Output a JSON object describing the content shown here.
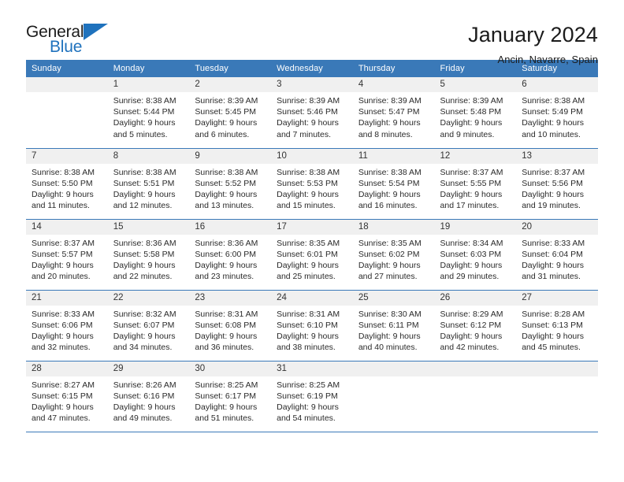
{
  "brand": {
    "name_top": "General",
    "name_bottom": "Blue",
    "accent_color": "#1f72bd"
  },
  "header": {
    "title": "January 2024",
    "subtitle": "Ancin, Navarre, Spain"
  },
  "calendar": {
    "header_bg": "#3a79b8",
    "daynum_bg": "#f0f0f0",
    "weekday_headers": [
      "Sunday",
      "Monday",
      "Tuesday",
      "Wednesday",
      "Thursday",
      "Friday",
      "Saturday"
    ],
    "weeks": [
      [
        {
          "day": "",
          "blank": true,
          "sunrise": "",
          "sunset": "",
          "daylight_1": "",
          "daylight_2": ""
        },
        {
          "day": "1",
          "sunrise": "Sunrise: 8:38 AM",
          "sunset": "Sunset: 5:44 PM",
          "daylight_1": "Daylight: 9 hours",
          "daylight_2": "and 5 minutes."
        },
        {
          "day": "2",
          "sunrise": "Sunrise: 8:39 AM",
          "sunset": "Sunset: 5:45 PM",
          "daylight_1": "Daylight: 9 hours",
          "daylight_2": "and 6 minutes."
        },
        {
          "day": "3",
          "sunrise": "Sunrise: 8:39 AM",
          "sunset": "Sunset: 5:46 PM",
          "daylight_1": "Daylight: 9 hours",
          "daylight_2": "and 7 minutes."
        },
        {
          "day": "4",
          "sunrise": "Sunrise: 8:39 AM",
          "sunset": "Sunset: 5:47 PM",
          "daylight_1": "Daylight: 9 hours",
          "daylight_2": "and 8 minutes."
        },
        {
          "day": "5",
          "sunrise": "Sunrise: 8:39 AM",
          "sunset": "Sunset: 5:48 PM",
          "daylight_1": "Daylight: 9 hours",
          "daylight_2": "and 9 minutes."
        },
        {
          "day": "6",
          "sunrise": "Sunrise: 8:38 AM",
          "sunset": "Sunset: 5:49 PM",
          "daylight_1": "Daylight: 9 hours",
          "daylight_2": "and 10 minutes."
        }
      ],
      [
        {
          "day": "7",
          "sunrise": "Sunrise: 8:38 AM",
          "sunset": "Sunset: 5:50 PM",
          "daylight_1": "Daylight: 9 hours",
          "daylight_2": "and 11 minutes."
        },
        {
          "day": "8",
          "sunrise": "Sunrise: 8:38 AM",
          "sunset": "Sunset: 5:51 PM",
          "daylight_1": "Daylight: 9 hours",
          "daylight_2": "and 12 minutes."
        },
        {
          "day": "9",
          "sunrise": "Sunrise: 8:38 AM",
          "sunset": "Sunset: 5:52 PM",
          "daylight_1": "Daylight: 9 hours",
          "daylight_2": "and 13 minutes."
        },
        {
          "day": "10",
          "sunrise": "Sunrise: 8:38 AM",
          "sunset": "Sunset: 5:53 PM",
          "daylight_1": "Daylight: 9 hours",
          "daylight_2": "and 15 minutes."
        },
        {
          "day": "11",
          "sunrise": "Sunrise: 8:38 AM",
          "sunset": "Sunset: 5:54 PM",
          "daylight_1": "Daylight: 9 hours",
          "daylight_2": "and 16 minutes."
        },
        {
          "day": "12",
          "sunrise": "Sunrise: 8:37 AM",
          "sunset": "Sunset: 5:55 PM",
          "daylight_1": "Daylight: 9 hours",
          "daylight_2": "and 17 minutes."
        },
        {
          "day": "13",
          "sunrise": "Sunrise: 8:37 AM",
          "sunset": "Sunset: 5:56 PM",
          "daylight_1": "Daylight: 9 hours",
          "daylight_2": "and 19 minutes."
        }
      ],
      [
        {
          "day": "14",
          "sunrise": "Sunrise: 8:37 AM",
          "sunset": "Sunset: 5:57 PM",
          "daylight_1": "Daylight: 9 hours",
          "daylight_2": "and 20 minutes."
        },
        {
          "day": "15",
          "sunrise": "Sunrise: 8:36 AM",
          "sunset": "Sunset: 5:58 PM",
          "daylight_1": "Daylight: 9 hours",
          "daylight_2": "and 22 minutes."
        },
        {
          "day": "16",
          "sunrise": "Sunrise: 8:36 AM",
          "sunset": "Sunset: 6:00 PM",
          "daylight_1": "Daylight: 9 hours",
          "daylight_2": "and 23 minutes."
        },
        {
          "day": "17",
          "sunrise": "Sunrise: 8:35 AM",
          "sunset": "Sunset: 6:01 PM",
          "daylight_1": "Daylight: 9 hours",
          "daylight_2": "and 25 minutes."
        },
        {
          "day": "18",
          "sunrise": "Sunrise: 8:35 AM",
          "sunset": "Sunset: 6:02 PM",
          "daylight_1": "Daylight: 9 hours",
          "daylight_2": "and 27 minutes."
        },
        {
          "day": "19",
          "sunrise": "Sunrise: 8:34 AM",
          "sunset": "Sunset: 6:03 PM",
          "daylight_1": "Daylight: 9 hours",
          "daylight_2": "and 29 minutes."
        },
        {
          "day": "20",
          "sunrise": "Sunrise: 8:33 AM",
          "sunset": "Sunset: 6:04 PM",
          "daylight_1": "Daylight: 9 hours",
          "daylight_2": "and 31 minutes."
        }
      ],
      [
        {
          "day": "21",
          "sunrise": "Sunrise: 8:33 AM",
          "sunset": "Sunset: 6:06 PM",
          "daylight_1": "Daylight: 9 hours",
          "daylight_2": "and 32 minutes."
        },
        {
          "day": "22",
          "sunrise": "Sunrise: 8:32 AM",
          "sunset": "Sunset: 6:07 PM",
          "daylight_1": "Daylight: 9 hours",
          "daylight_2": "and 34 minutes."
        },
        {
          "day": "23",
          "sunrise": "Sunrise: 8:31 AM",
          "sunset": "Sunset: 6:08 PM",
          "daylight_1": "Daylight: 9 hours",
          "daylight_2": "and 36 minutes."
        },
        {
          "day": "24",
          "sunrise": "Sunrise: 8:31 AM",
          "sunset": "Sunset: 6:10 PM",
          "daylight_1": "Daylight: 9 hours",
          "daylight_2": "and 38 minutes."
        },
        {
          "day": "25",
          "sunrise": "Sunrise: 8:30 AM",
          "sunset": "Sunset: 6:11 PM",
          "daylight_1": "Daylight: 9 hours",
          "daylight_2": "and 40 minutes."
        },
        {
          "day": "26",
          "sunrise": "Sunrise: 8:29 AM",
          "sunset": "Sunset: 6:12 PM",
          "daylight_1": "Daylight: 9 hours",
          "daylight_2": "and 42 minutes."
        },
        {
          "day": "27",
          "sunrise": "Sunrise: 8:28 AM",
          "sunset": "Sunset: 6:13 PM",
          "daylight_1": "Daylight: 9 hours",
          "daylight_2": "and 45 minutes."
        }
      ],
      [
        {
          "day": "28",
          "sunrise": "Sunrise: 8:27 AM",
          "sunset": "Sunset: 6:15 PM",
          "daylight_1": "Daylight: 9 hours",
          "daylight_2": "and 47 minutes."
        },
        {
          "day": "29",
          "sunrise": "Sunrise: 8:26 AM",
          "sunset": "Sunset: 6:16 PM",
          "daylight_1": "Daylight: 9 hours",
          "daylight_2": "and 49 minutes."
        },
        {
          "day": "30",
          "sunrise": "Sunrise: 8:25 AM",
          "sunset": "Sunset: 6:17 PM",
          "daylight_1": "Daylight: 9 hours",
          "daylight_2": "and 51 minutes."
        },
        {
          "day": "31",
          "sunrise": "Sunrise: 8:25 AM",
          "sunset": "Sunset: 6:19 PM",
          "daylight_1": "Daylight: 9 hours",
          "daylight_2": "and 54 minutes."
        },
        {
          "day": "",
          "blank": true,
          "sunrise": "",
          "sunset": "",
          "daylight_1": "",
          "daylight_2": ""
        },
        {
          "day": "",
          "blank": true,
          "sunrise": "",
          "sunset": "",
          "daylight_1": "",
          "daylight_2": ""
        },
        {
          "day": "",
          "blank": true,
          "sunrise": "",
          "sunset": "",
          "daylight_1": "",
          "daylight_2": ""
        }
      ]
    ]
  }
}
